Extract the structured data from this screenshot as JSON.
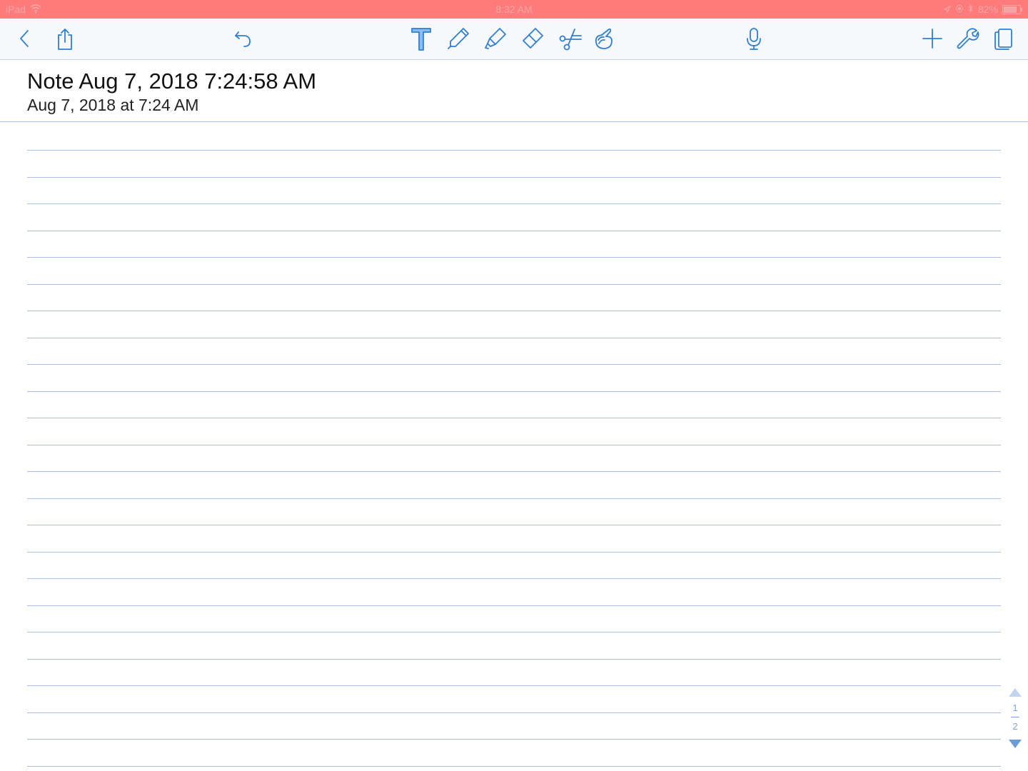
{
  "status_bar": {
    "device": "iPad",
    "time": "8:32 AM",
    "battery": "82%",
    "battery_level": 0.82
  },
  "toolbar": {
    "left": [
      {
        "name": "back-icon",
        "icon": "chevron-left"
      },
      {
        "name": "share-icon",
        "icon": "share-box-arrow-up"
      }
    ],
    "undo": {
      "name": "undo-icon",
      "icon": "undo-arrow"
    },
    "tools": [
      {
        "name": "text-tool-icon",
        "icon": "letter-T",
        "selected": true
      },
      {
        "name": "pen-tool-icon",
        "icon": "pen"
      },
      {
        "name": "highlighter-tool-icon",
        "icon": "highlighter"
      },
      {
        "name": "eraser-tool-icon",
        "icon": "eraser"
      },
      {
        "name": "scissors-tool-icon",
        "icon": "scissors"
      },
      {
        "name": "pointer-tool-icon",
        "icon": "hand-pointer"
      }
    ],
    "mic": {
      "name": "microphone-icon",
      "icon": "microphone"
    },
    "right": [
      {
        "name": "add-icon",
        "icon": "plus"
      },
      {
        "name": "settings-wrench-icon",
        "icon": "wrench"
      },
      {
        "name": "pages-icon",
        "icon": "page-stack"
      }
    ],
    "icon_color": "#2f7fd0"
  },
  "note": {
    "title": "Note Aug 7, 2018 7:24:58 AM",
    "date": "Aug 7, 2018 at 7:24 AM"
  },
  "paper": {
    "style": "ruled",
    "rule_color": "#a9c0e4"
  },
  "page_nav": {
    "current": "1",
    "total": "2"
  },
  "colors": {
    "status_bar": "#ff7b7b",
    "toolbar_bg": "#f7f8fc",
    "accent": "#2f7fd0"
  }
}
